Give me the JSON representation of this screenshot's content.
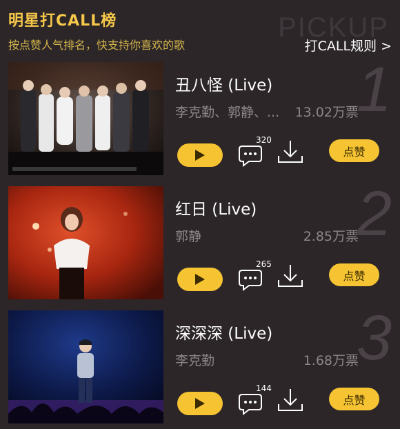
{
  "header": {
    "title": "明星打CALL榜",
    "subtitle": "按点赞人气排名，快支持你喜欢的歌",
    "watermark": "PICKUP",
    "rules_link": "打CALL规则 >"
  },
  "songs": [
    {
      "rank": "1",
      "title": "丑八怪 (Live)",
      "artist": "李克勤、郭静、...",
      "votes": "13.02万票",
      "comments": "320",
      "like_label": "点赞"
    },
    {
      "rank": "2",
      "title": "红日 (Live)",
      "artist": "郭静",
      "votes": "2.85万票",
      "comments": "265",
      "like_label": "点赞"
    },
    {
      "rank": "3",
      "title": "深深深 (Live)",
      "artist": "李克勤",
      "votes": "1.68万票",
      "comments": "144",
      "like_label": "点赞"
    }
  ],
  "colors": {
    "accent": "#f6c433",
    "title": "#f6c84a",
    "background": "#2c2629",
    "muted_text": "#8d8689"
  },
  "icons": [
    "play-icon",
    "comment-icon",
    "download-icon"
  ]
}
